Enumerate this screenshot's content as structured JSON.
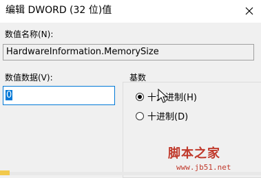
{
  "title": "编辑 DWORD (32 位)值",
  "value_name_label": "数值名称(N):",
  "value_name": "HardwareInformation.MemorySize",
  "value_data_label": "数值数据(V):",
  "value_data": "0",
  "base_group_label": "基数",
  "radio_hex_label": "十六进制(H)",
  "radio_dec_label": "十进制(D)",
  "radio_hex_checked": true,
  "watermark_text": "脚本之家",
  "watermark_url": "www.jb51.net",
  "icons": {
    "close": "close-icon",
    "cursor": "mouse-cursor-icon",
    "folder": "folder-icon"
  }
}
